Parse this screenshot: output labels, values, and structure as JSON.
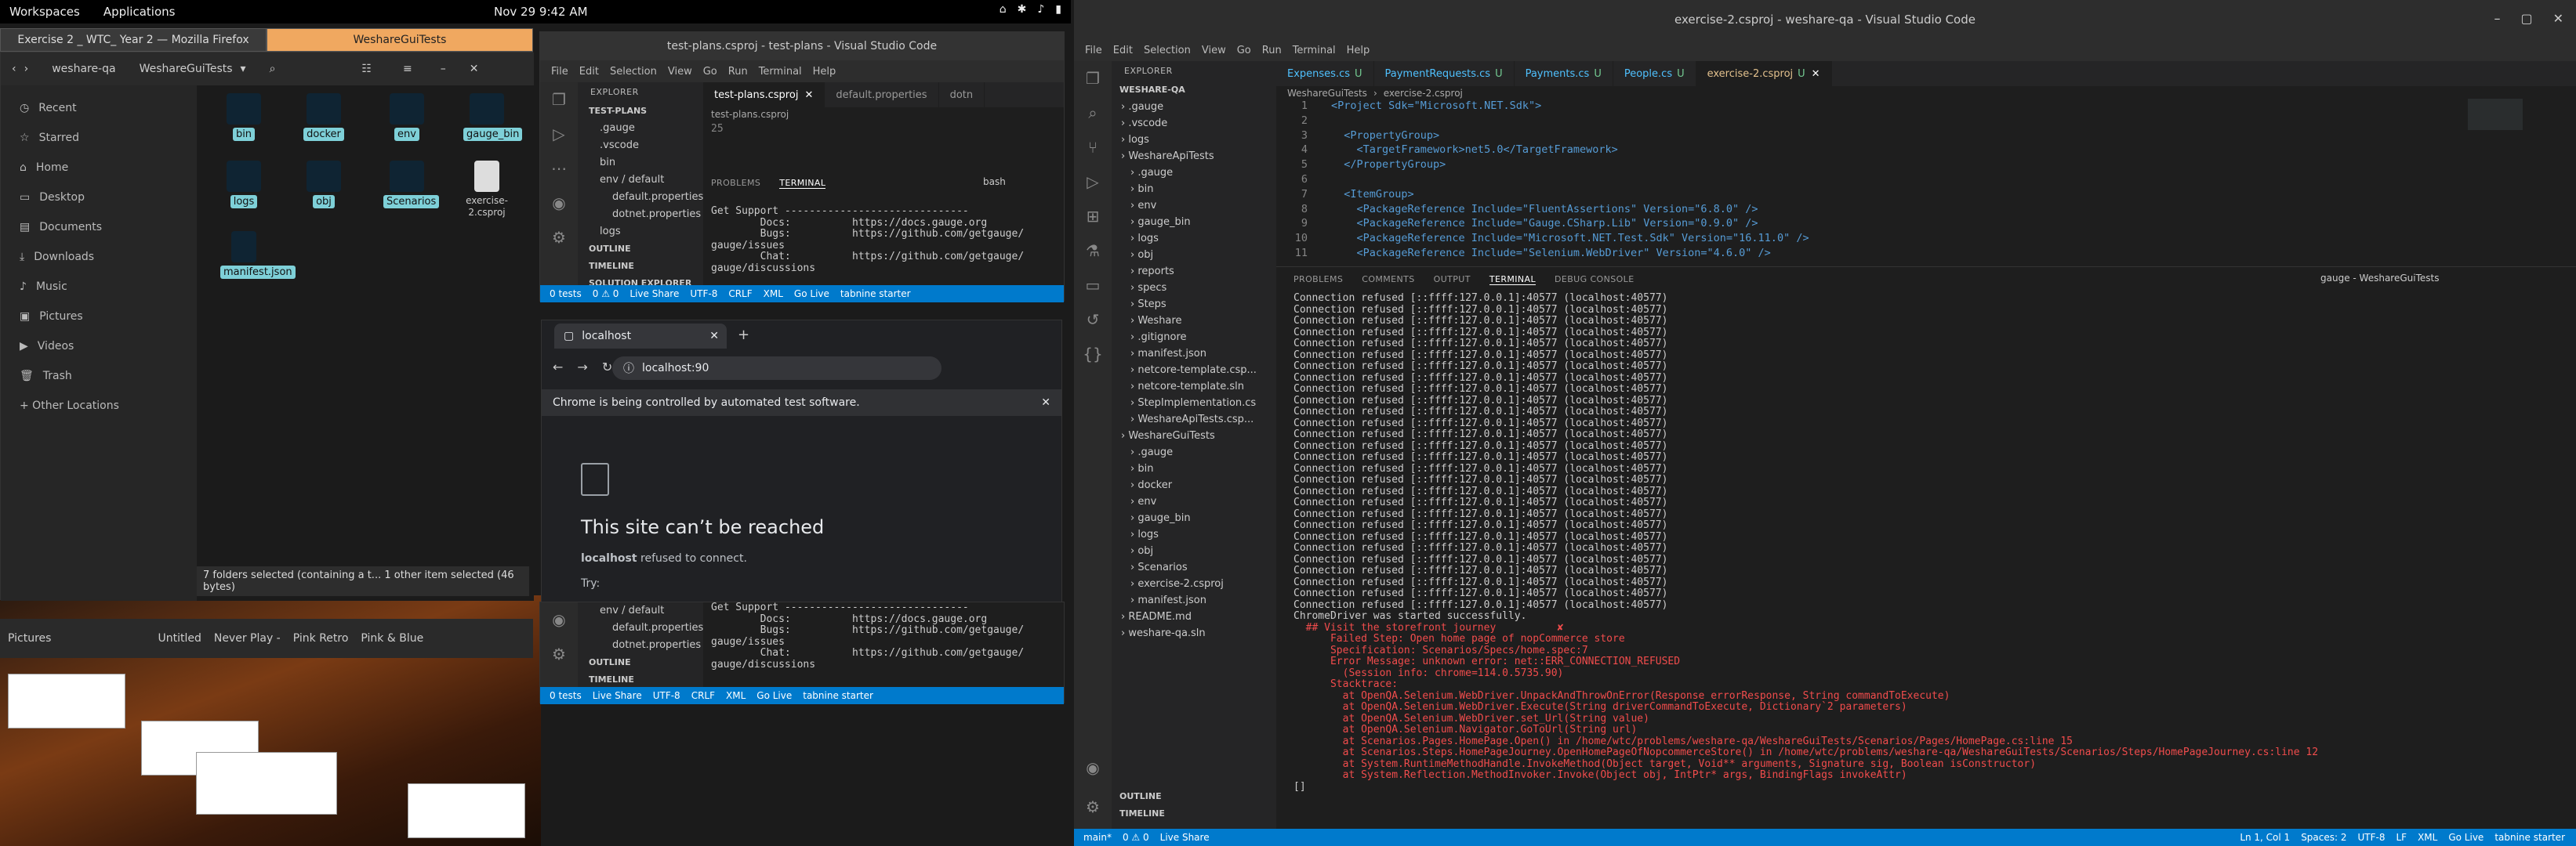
{
  "topbar": {
    "workspaces": "Workspaces",
    "applications": "Applications",
    "clock": "Nov 29  9:42 AM"
  },
  "firefox_tabs": [
    "Exercise 2 _ WTC_ Year 2 — Mozilla Firefox",
    "WeshareGuiTests"
  ],
  "nautilus": {
    "path": [
      "weshare-qa",
      "WeshareGuiTests"
    ],
    "sidebar": [
      "Recent",
      "Starred",
      "Home",
      "Desktop",
      "Documents",
      "Downloads",
      "Music",
      "Pictures",
      "Videos",
      "Trash",
      "+ Other Locations"
    ],
    "items": [
      "bin",
      "docker",
      "env",
      "gauge_bin",
      "logs",
      "obj",
      "Scenarios",
      "exercise-2.csproj",
      "manifest.json"
    ],
    "status": "7 folders selected (containing a t... 1 other item selected (46 bytes)"
  },
  "vsc1": {
    "title": "test-plans.csproj - test-plans - Visual Studio Code",
    "menu": [
      "File",
      "Edit",
      "Selection",
      "View",
      "Go",
      "Run",
      "Terminal",
      "Help"
    ],
    "explorer_label": "EXPLORER",
    "tree": [
      "TEST-PLANS",
      ".gauge",
      ".vscode",
      "bin",
      "env / default",
      "default.properties",
      "dotnet.properties",
      "logs",
      "OUTLINE",
      "TIMELINE",
      "SOLUTION EXPLORER"
    ],
    "tabs": [
      "test-plans.csproj",
      "default.properties",
      "dotn"
    ],
    "crumb": "test-plans.csproj",
    "line": "25",
    "panel_tabs": [
      "PROBLEMS",
      "TERMINAL"
    ],
    "shell": "bash",
    "terminal": [
      "Get Support ------------------------------",
      "        Docs:          https://docs.gauge.org",
      "        Bugs:          https://github.com/getgauge/",
      "gauge/issues",
      "        Chat:          https://github.com/getgauge/",
      "gauge/discussions"
    ],
    "status": [
      "0 tests",
      "0 ⚠ 0",
      "Live Share",
      "UTF-8",
      "CRLF",
      "XML",
      "Go Live",
      "tabnine starter"
    ]
  },
  "chrome": {
    "tab": "localhost",
    "url": "localhost:90",
    "info": "Chrome is being controlled by automated test software.",
    "heading": "This site can’t be reached",
    "host": "localhost",
    "msg": " refused to connect.",
    "try": "Try:"
  },
  "vsc2": {
    "tree": [
      "env / default",
      "default.properties",
      "dotnet.properties",
      "OUTLINE",
      "TIMELINE"
    ],
    "terminal": [
      "Get Support ------------------------------",
      "        Docs:          https://docs.gauge.org",
      "        Bugs:          https://github.com/getgauge/",
      "gauge/issues",
      "        Chat:          https://github.com/getgauge/",
      "gauge/discussions"
    ],
    "status": [
      "0 tests",
      "Live Share",
      "UTF-8",
      "CRLF",
      "XML",
      "Go Live",
      "tabnine starter"
    ]
  },
  "dock": {
    "pictures": "Pictures",
    "items": [
      "Untitled",
      "Never Play -",
      "Pink Retro",
      "Pink & Blue"
    ]
  },
  "vsc3": {
    "title": "exercise-2.csproj - weshare-qa - Visual Studio Code",
    "menu": [
      "File",
      "Edit",
      "Selection",
      "View",
      "Go",
      "Run",
      "Terminal",
      "Help"
    ],
    "explorer_label": "EXPLORER",
    "root": "WESHARE-QA",
    "tree": [
      {
        "n": ".gauge",
        "d": 1
      },
      {
        "n": ".vscode",
        "d": 1
      },
      {
        "n": "logs",
        "d": 1
      },
      {
        "n": "WeshareApiTests",
        "d": 1
      },
      {
        "n": ".gauge",
        "d": 2
      },
      {
        "n": "bin",
        "d": 2
      },
      {
        "n": "env",
        "d": 2
      },
      {
        "n": "gauge_bin",
        "d": 2
      },
      {
        "n": "logs",
        "d": 2
      },
      {
        "n": "obj",
        "d": 2
      },
      {
        "n": "reports",
        "d": 2
      },
      {
        "n": "specs",
        "d": 2
      },
      {
        "n": "Steps",
        "d": 2
      },
      {
        "n": "Weshare",
        "d": 2
      },
      {
        "n": ".gitignore",
        "d": 2
      },
      {
        "n": "manifest.json",
        "d": 2
      },
      {
        "n": "netcore-template.csp...",
        "d": 2
      },
      {
        "n": "netcore-template.sln",
        "d": 2
      },
      {
        "n": "StepImplementation.cs",
        "d": 2
      },
      {
        "n": "WeshareApiTests.csp...",
        "d": 2
      },
      {
        "n": "WeshareGuiTests",
        "d": 1
      },
      {
        "n": ".gauge",
        "d": 2
      },
      {
        "n": "bin",
        "d": 2
      },
      {
        "n": "docker",
        "d": 2
      },
      {
        "n": "env",
        "d": 2
      },
      {
        "n": "gauge_bin",
        "d": 2
      },
      {
        "n": "logs",
        "d": 2
      },
      {
        "n": "obj",
        "d": 2
      },
      {
        "n": "Scenarios",
        "d": 2
      },
      {
        "n": "exercise-2.csproj",
        "d": 2
      },
      {
        "n": "manifest.json",
        "d": 2
      },
      {
        "n": "README.md",
        "d": 1
      },
      {
        "n": "weshare-qa.sln",
        "d": 1
      }
    ],
    "outline": "OUTLINE",
    "timeline": "TIMELINE",
    "tabs": [
      "Expenses.cs",
      "PaymentRequests.cs",
      "Payments.cs",
      "People.cs",
      "exercise-2.csproj"
    ],
    "crumbs": [
      "WeshareGuiTests",
      "exercise-2.csproj"
    ],
    "code": [
      "<Project Sdk=\"Microsoft.NET.Sdk\">",
      "",
      "  <PropertyGroup>",
      "    <TargetFramework>net5.0</TargetFramework>",
      "  </PropertyGroup>",
      "",
      "  <ItemGroup>",
      "    <PackageReference Include=\"FluentAssertions\" Version=\"6.8.0\" />",
      "    <PackageReference Include=\"Gauge.CSharp.Lib\" Version=\"0.9.0\" />",
      "    <PackageReference Include=\"Microsoft.NET.Test.Sdk\" Version=\"16.11.0\" />",
      "    <PackageReference Include=\"Selenium.WebDriver\" Version=\"4.6.0\" />"
    ],
    "panel_tabs": [
      "PROBLEMS",
      "COMMENTS",
      "OUTPUT",
      "TERMINAL",
      "DEBUG CONSOLE"
    ],
    "terminal_name": "gauge - WeshareGuiTests",
    "refused": "Connection refused [::ffff:127.0.0.1]:40577 (localhost:40577)",
    "refused_count": 28,
    "chromedriver": "ChromeDriver was started successfully.",
    "scenario": "  ## Visit the storefront journey          ✘",
    "failure": [
      "      Failed Step: Open home page of nopCommerce store",
      "      Specification: Scenarios/Specs/home.spec:7",
      "      Error Message: unknown error: net::ERR_CONNECTION_REFUSED",
      "        (Session info: chrome=114.0.5735.90)",
      "      Stacktrace:",
      "        at OpenQA.Selenium.WebDriver.UnpackAndThrowOnError(Response errorResponse, String commandToExecute)",
      "        at OpenQA.Selenium.WebDriver.Execute(String driverCommandToExecute, Dictionary`2 parameters)",
      "        at OpenQA.Selenium.WebDriver.set_Url(String value)",
      "        at OpenQA.Selenium.Navigator.GoToUrl(String url)",
      "        at Scenarios.Pages.HomePage.Open() in /home/wtc/problems/weshare-qa/WeshareGuiTests/Scenarios/Pages/HomePage.cs:line 15",
      "        at Scenarios.Steps.HomePageJourney.OpenHomePageOfNopcommerceStore() in /home/wtc/problems/weshare-qa/WeshareGuiTests/Scenarios/Steps/HomePageJourney.cs:line 12",
      "        at System.RuntimeMethodHandle.InvokeMethod(Object target, Void** arguments, Signature sig, Boolean isConstructor)",
      "        at System.Reflection.MethodInvoker.Invoke(Object obj, IntPtr* args, BindingFlags invokeAttr)"
    ],
    "prompt": "[]",
    "status_left": [
      "main*",
      "0 ⚠ 0",
      "Live Share"
    ],
    "status_right": [
      "Ln 1, Col 1",
      "Spaces: 2",
      "UTF-8",
      "LF",
      "XML",
      "Go Live",
      "tabnine starter"
    ]
  },
  "colors": {
    "accent": "#007acc",
    "error": "#f14c4c",
    "folder_label": "#7ed0d8"
  }
}
